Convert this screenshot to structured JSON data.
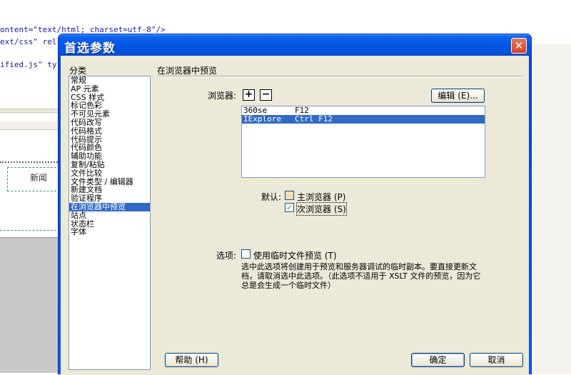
{
  "background": {
    "code_lines": [
      "ontent=\"text/html; charset=utf-8\"/>",
      "ext/css\" rel",
      "ified.js\" ty"
    ],
    "design_cell_text": "新闻"
  },
  "dialog": {
    "title": "首选参数",
    "close_symbol": "✕",
    "category_label": "分类",
    "categories": [
      "常规",
      "AP 元素",
      "CSS 样式",
      "标记色彩",
      "不可见元素",
      "代码改写",
      "代码格式",
      "代码提示",
      "代码颜色",
      "辅助功能",
      "复制/粘贴",
      "文件比较",
      "文件类型 / 编辑器",
      "新建文档",
      "验证程序",
      "在浏览器中预览",
      "站点",
      "状态栏",
      "字体"
    ],
    "selected_category": "在浏览器中预览",
    "panel_title": "在浏览器中预览",
    "browsers_label": "浏览器:",
    "add_symbol": "+",
    "remove_symbol": "−",
    "edit_button": "编辑 (E)...",
    "browsers": [
      {
        "name": "360se",
        "key": "F12",
        "selected": false
      },
      {
        "name": "IExplore",
        "key": "Ctrl F12",
        "selected": true
      }
    ],
    "default_label": "默认:",
    "primary_browser": "主浏览器 (P)",
    "secondary_browser": "次浏览器 (S)",
    "options_label": "选项:",
    "temp_file_option": "使用临时文件预览 (T)",
    "description": "选中此选项将创建用于预览和服务器调试的临时副本。要直接更新文档，请取消选中此选项。（此选项不适用于 XSLT 文件的预览，因为它总是会生成一个临时文件）",
    "help_button": "帮助 (H)",
    "ok_button": "确定",
    "cancel_button": "取消",
    "checkmark_symbol": "✓"
  }
}
